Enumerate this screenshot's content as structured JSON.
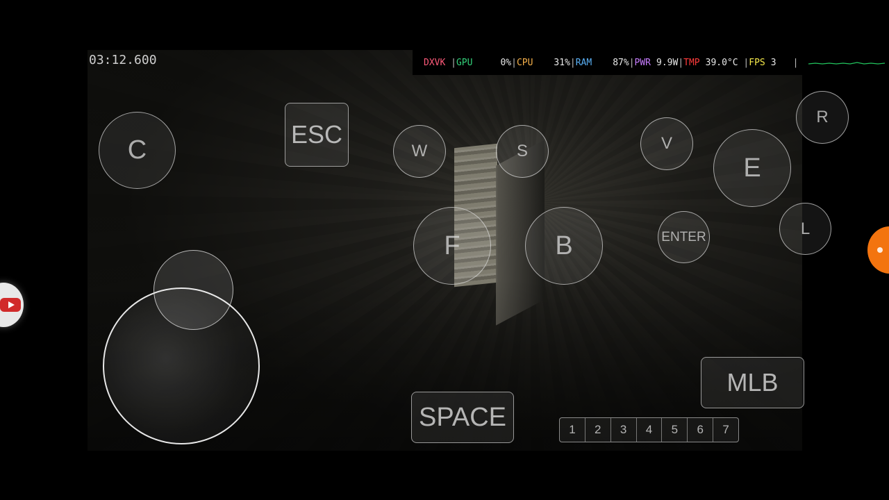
{
  "timer": "03:12.600",
  "hud": {
    "dxvk": "DXVK",
    "gpu_label": "GPU",
    "gpu_value": "0%",
    "cpu_label": "CPU",
    "cpu_value": "31%",
    "ram_label": "RAM",
    "ram_value": "87%",
    "pwr_label": "PWR",
    "pwr_value": "9.9W",
    "tmp_label": "TMP",
    "tmp_value": "39.0°C",
    "fps_label": "FPS",
    "fps_value": "3",
    "colors": {
      "dxvk": "#ff5a7a",
      "gpu": "#33d17a",
      "cpu": "#f5b04a",
      "ram": "#5ab0f5",
      "pwr": "#c77dff",
      "tmp": "#ff3b3b",
      "fps": "#f5e94a",
      "graph": "#22c55e"
    }
  },
  "buttons": {
    "c": "C",
    "esc": "ESC",
    "w": "W",
    "s": "S",
    "v": "V",
    "r": "R",
    "e": "E",
    "l": "L",
    "f": "F",
    "b": "B",
    "enter": "ENTER",
    "space": "SPACE",
    "mlb": "MLB"
  },
  "hotbar": [
    "1",
    "2",
    "3",
    "4",
    "5",
    "6",
    "7"
  ],
  "side_icons": {
    "left": "youtube-icon",
    "right": "floating-menu-icon",
    "accent": "#f3740f"
  }
}
